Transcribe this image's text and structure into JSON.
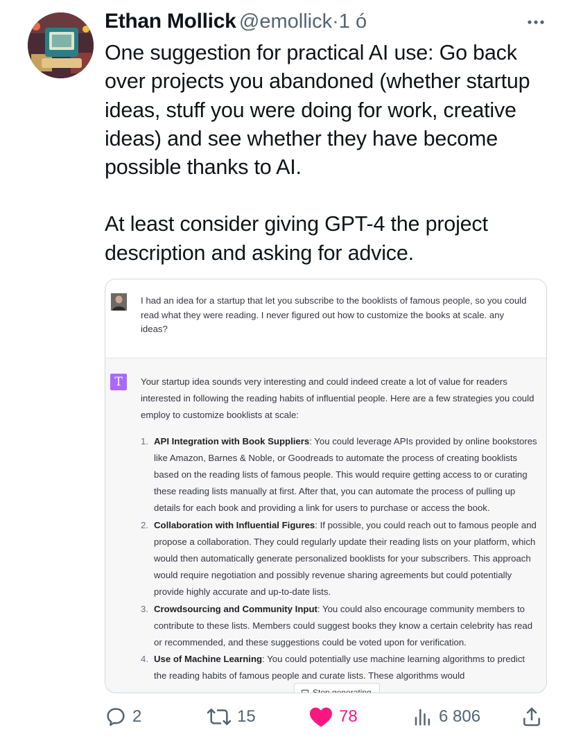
{
  "tweet": {
    "author_name": "Ethan Mollick",
    "handle": "@emollick",
    "separator": "·",
    "age": "1 ó",
    "paragraphs": [
      "One suggestion for practical AI use: Go back over projects you abandoned (whether startup ideas, stuff you were doing for work, creative ideas) and see whether they have become possible thanks to AI.",
      "At least consider giving GPT-4 the project description and asking for advice."
    ]
  },
  "media": {
    "user_message": "I had an idea for a startup that let you subscribe to the booklists of famous people, so you could read what they were reading. I never figured out how to customize the books at scale. any ideas?",
    "assistant_avatar_letter": "T",
    "assistant_intro": "Your startup idea sounds very interesting and could indeed create a lot of value for readers interested in following the reading habits of influential people. Here are a few strategies you could employ to customize booklists at scale:",
    "items": [
      {
        "num": "1.",
        "title": "API Integration with Book Suppliers",
        "text": ": You could leverage APIs provided by online bookstores like Amazon, Barnes & Noble, or Goodreads to automate the process of creating booklists based on the reading lists of famous people. This would require getting access to or curating these reading lists manually at first. After that, you can automate the process of pulling up details for each book and providing a link for users to purchase or access the book."
      },
      {
        "num": "2.",
        "title": "Collaboration with Influential Figures",
        "text": ": If possible, you could reach out to famous people and propose a collaboration. They could regularly update their reading lists on your platform, which would then automatically generate personalized booklists for your subscribers. This approach would require negotiation and possibly revenue sharing agreements but could potentially provide highly accurate and up-to-date lists."
      },
      {
        "num": "3.",
        "title": "Crowdsourcing and Community Input",
        "text": ": You could also encourage community members to contribute to these lists. Members could suggest books they know a certain celebrity has read or recommended, and these suggestions could be voted upon for verification."
      },
      {
        "num": "4.",
        "title": "Use of Machine Learning",
        "text": ": You could potentially use machine learning algorithms to predict the reading habits of famous people and curate lists. These algorithms would"
      }
    ],
    "stop_button_label": "Stop generating"
  },
  "actions": {
    "replies": "2",
    "reposts": "15",
    "likes": "78",
    "views": "6 806"
  },
  "colors": {
    "like": "#f91880",
    "muted": "#536471",
    "assistant_avatar": "#ab68ff"
  },
  "icons": [
    "more-icon",
    "reply-icon",
    "repost-icon",
    "like-icon",
    "views-icon",
    "share-icon",
    "stop-icon"
  ]
}
